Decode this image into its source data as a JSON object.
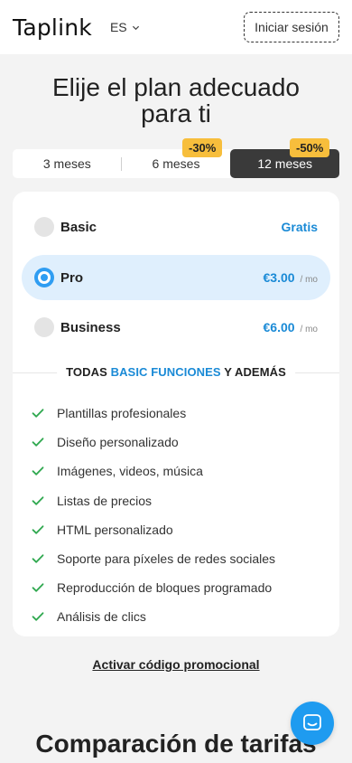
{
  "header": {
    "logo": "Taplink",
    "language": "ES",
    "login_label": "Iniciar sesión"
  },
  "title": "Elije el plan adecuado para ti",
  "periods": [
    {
      "label": "3 meses",
      "badge": null,
      "active": false
    },
    {
      "label": "6 meses",
      "badge": "-30%",
      "active": false
    },
    {
      "label": "12 meses",
      "badge": "-50%",
      "active": true
    }
  ],
  "plans": [
    {
      "name": "Basic",
      "price": "Gratis",
      "unit": "",
      "selected": false
    },
    {
      "name": "Pro",
      "price": "€3.00",
      "unit": "/ mo",
      "selected": true
    },
    {
      "name": "Business",
      "price": "€6.00",
      "unit": "/ mo",
      "selected": false
    }
  ],
  "features_heading": {
    "prefix": "TODAS",
    "highlight": "BASIC FUNCIONES",
    "suffix": "Y ADEMÁS"
  },
  "features": [
    "Plantillas profesionales",
    "Diseño personalizado",
    "Imágenes, videos, música",
    "Listas de precios",
    "HTML personalizado",
    "Soporte para píxeles de redes sociales",
    "Reproducción de bloques programado",
    "Análisis de clics"
  ],
  "promo_link": "Activar código promocional",
  "comparison_title": "Comparación de tarifas",
  "colors": {
    "accent": "#1a8ad6",
    "badge": "#f7be3c",
    "selected_bg": "#dfeffd",
    "check": "#2fa84f"
  },
  "icons": {
    "lang_chevron": "chevron-down-icon",
    "feature_check": "check-icon",
    "chat": "chat-icon"
  }
}
